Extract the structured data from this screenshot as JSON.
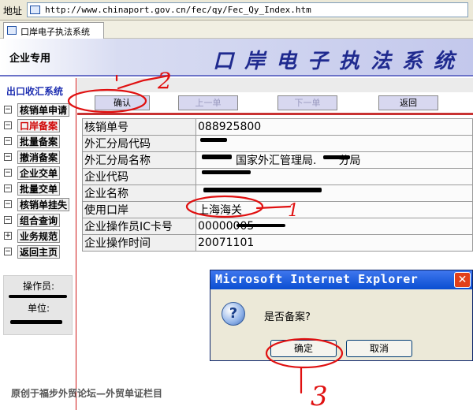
{
  "address_bar": {
    "label": "地址",
    "url": "http://www.chinaport.gov.cn/fec/qy/Fec_Qy_Index.htm"
  },
  "browser_tab": {
    "title": "口岸电子执法系统"
  },
  "header": {
    "left_label": "企业专用",
    "title": "口岸电子执法系统"
  },
  "sidebar": {
    "section_title": "出口收汇系统",
    "items": [
      {
        "label": "核销单申请",
        "box": "−",
        "active": false
      },
      {
        "label": "口岸备案",
        "box": "−",
        "active": true
      },
      {
        "label": "批量备案",
        "box": "−",
        "active": false
      },
      {
        "label": "撤消备案",
        "box": "−",
        "active": false
      },
      {
        "label": "企业交单",
        "box": "−",
        "active": false
      },
      {
        "label": "批量交单",
        "box": "−",
        "active": false
      },
      {
        "label": "核销单挂失",
        "box": "−",
        "active": false
      },
      {
        "label": "组合查询",
        "box": "−",
        "active": false
      },
      {
        "label": "业务规范",
        "box": "+",
        "active": false
      },
      {
        "label": "返回主页",
        "box": "−",
        "active": false
      }
    ],
    "operator_label": "操作员:",
    "unit_label": "单位:"
  },
  "toolbar": {
    "confirm": "确认",
    "prev": "上一单",
    "next": "下一单",
    "back": "返回"
  },
  "form": {
    "rows": [
      {
        "key": "核销单号",
        "value": "088925800"
      },
      {
        "key": "外汇分局代码",
        "value": ""
      },
      {
        "key": "外汇分局名称",
        "value": "国家外汇管理局.　　分局"
      },
      {
        "key": "企业代码",
        "value": ""
      },
      {
        "key": "企业名称",
        "value": ""
      },
      {
        "key": "使用口岸",
        "value": "上海海关"
      },
      {
        "key": "企业操作员IC卡号",
        "value": "00000005"
      },
      {
        "key": "企业操作时间",
        "value": "20071101"
      }
    ]
  },
  "dialog": {
    "title": "Microsoft Internet Explorer",
    "message": "是否备案?",
    "ok": "确定",
    "cancel": "取消"
  },
  "watermark": "原创于福步外贸论坛—外贸单证栏目",
  "annotations": {
    "mark_1": "1",
    "mark_2": "2",
    "mark_3": "3"
  },
  "colors": {
    "annotation": "#e01010",
    "sidebar_active": "#d00000",
    "title_blue": "#1f2a8f",
    "dialog_titlebar": "#0a4ed1"
  }
}
